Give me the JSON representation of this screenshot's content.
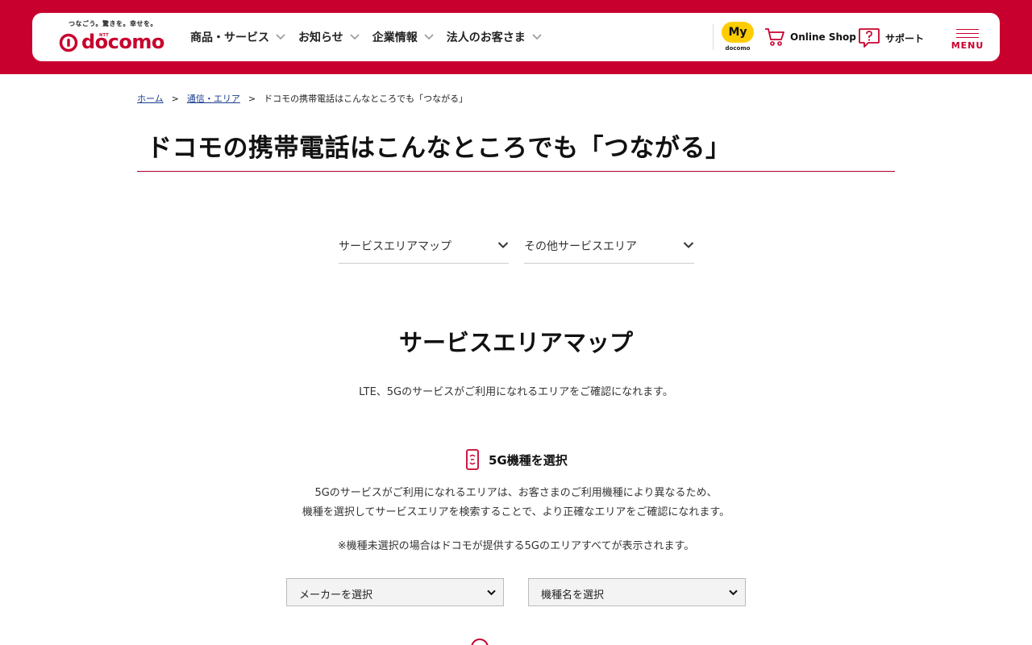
{
  "colors": {
    "brand": "#c8002e",
    "my_docomo_yellow": "#ffcc00",
    "link": "#1a3d8f"
  },
  "header": {
    "logo": {
      "tagline": "つなごう。驚きを。幸せを。",
      "ntt": "NTT",
      "wordmark": "docomo"
    },
    "nav": [
      {
        "label": "商品・サービス"
      },
      {
        "label": "お知らせ"
      },
      {
        "label": "企業情報"
      },
      {
        "label": "法人のお客さま"
      }
    ],
    "my_docomo": {
      "badge": "My",
      "sub": "docomo"
    },
    "online_shop": {
      "label": "Online Shop",
      "icon": "cart-icon"
    },
    "support": {
      "label": "サポート",
      "icon": "question-bubble-icon"
    },
    "menu": {
      "label": "MENU"
    }
  },
  "breadcrumb": {
    "items": [
      {
        "label": "ホーム"
      },
      {
        "label": "通信・エリア"
      },
      {
        "label": "ドコモの携帯電話はこんなところでも「つながる」"
      }
    ],
    "separator": ">"
  },
  "page": {
    "title": "ドコモの携帯電話はこんなところでも「つながる」"
  },
  "anchors": [
    {
      "label": "サービスエリアマップ"
    },
    {
      "label": "その他サービスエリア"
    }
  ],
  "section": {
    "title": "サービスエリアマップ",
    "description": "LTE、5Gのサービスがご利用になれるエリアをご確認になれます。",
    "sub_heading": "5G機種を選択",
    "para1": "5Gのサービスがご利用になれるエリアは、お客さまのご利用機種により異なるため、",
    "para2": "機種を選択してサービスエリアを検索することで、より正確なエリアをご確認になれます。",
    "note": "※機種未選択の場合はドコモが提供する5Gのエリアすべてが表示されます。",
    "selects": [
      {
        "label": "メーカーを選択"
      },
      {
        "label": "機種名を選択"
      }
    ]
  }
}
